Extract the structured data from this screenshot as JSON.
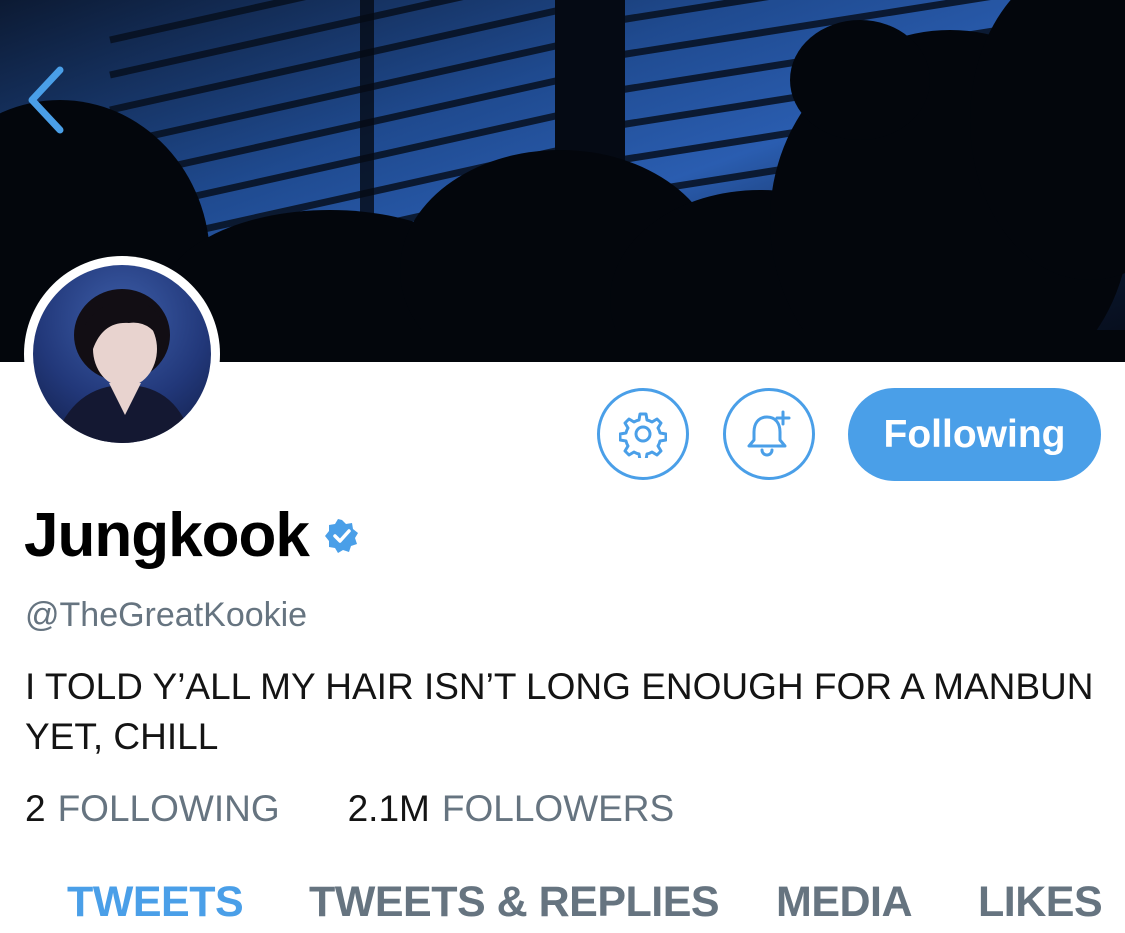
{
  "profile": {
    "display_name": "Jungkook",
    "handle": "@TheGreatKookie",
    "bio": "I TOLD Y’ALL MY HAIR ISN’T LONG ENOUGH FOR A MANBUN YET, CHILL",
    "verified": true
  },
  "actions": {
    "settings_icon": "gear-icon",
    "notify_icon": "bell-plus-icon",
    "follow_label": "Following"
  },
  "stats": {
    "following_count": "2",
    "following_label": "FOLLOWING",
    "followers_count": "2.1M",
    "followers_label": "FOLLOWERS"
  },
  "tabs": [
    {
      "label": "TWEETS",
      "active": true
    },
    {
      "label": "TWEETS & REPLIES",
      "active": false
    },
    {
      "label": "MEDIA",
      "active": false
    },
    {
      "label": "LIKES",
      "active": false
    }
  ],
  "colors": {
    "accent": "#4a9fe8",
    "secondary_text": "#667480",
    "primary_text": "#141414"
  },
  "icons": {
    "back": "chevron-left-icon",
    "verified": "verified-badge-icon"
  }
}
